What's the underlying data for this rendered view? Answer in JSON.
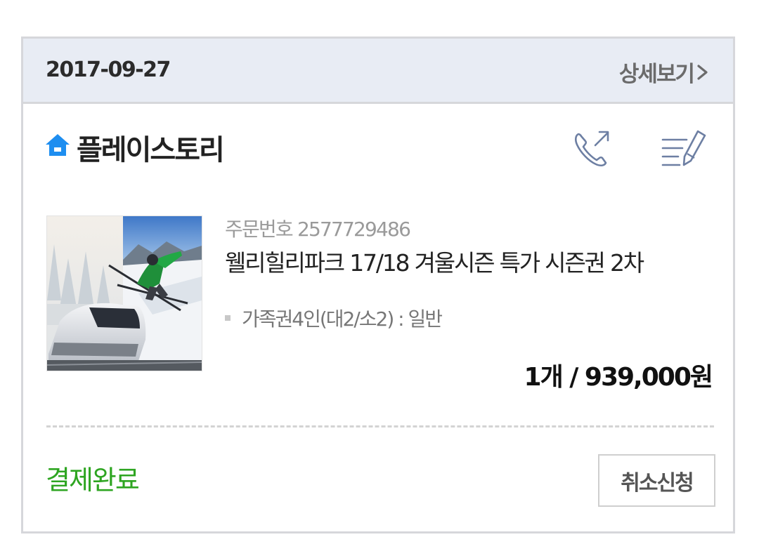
{
  "order": {
    "date": "2017-09-27",
    "detail_link_label": "상세보기",
    "store_name": "플레이스토리",
    "order_number_text": "주문번호 2577729486",
    "product_name": "웰리힐리파크 17/18 겨울시즌 특가 시즌권 2차",
    "option_text": "가족권4인(대2/소2) : 일반",
    "quantity_price": "1개 / 939,000원",
    "status": "결제완료",
    "cancel_button_label": "취소신청"
  },
  "icons": {
    "store": "home-icon",
    "call": "phone-icon",
    "review": "write-review-icon",
    "detail": "chevron-right-icon"
  },
  "colors": {
    "header_background": "#e8ecf4",
    "status_green": "#2ea521",
    "home_blue": "#1e8ef0",
    "icon_gray_blue": "#6d7fa3"
  }
}
